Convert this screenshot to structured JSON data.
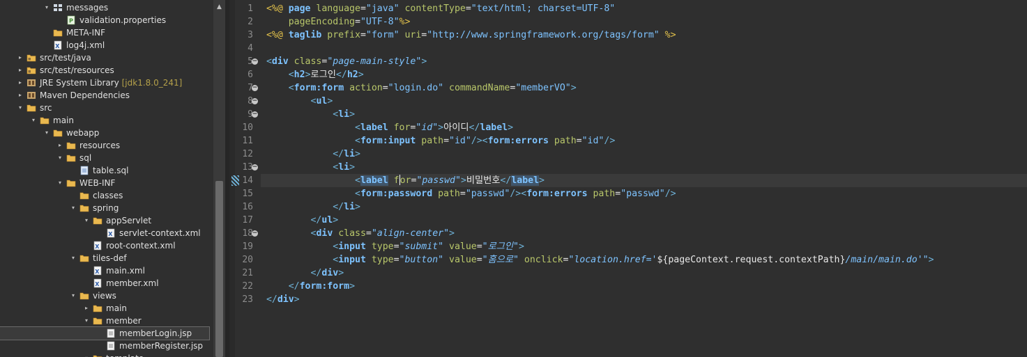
{
  "explorer": {
    "rows": [
      {
        "label": "messages",
        "twisty": "▾",
        "icon": "package-icon",
        "decoration": ""
      },
      {
        "label": "validation.properties",
        "twisty": "",
        "icon": "properties-file-icon",
        "decoration": ""
      },
      {
        "label": "META-INF",
        "twisty": "",
        "icon": "folder-icon",
        "decoration": ""
      },
      {
        "label": "log4j.xml",
        "twisty": "",
        "icon": "xml-file-icon",
        "decoration": ""
      },
      {
        "label": "src/test/java",
        "twisty": "▸",
        "icon": "source-folder-icon",
        "decoration": ""
      },
      {
        "label": "src/test/resources",
        "twisty": "▸",
        "icon": "source-folder-icon",
        "decoration": ""
      },
      {
        "label": "JRE System Library",
        "twisty": "▸",
        "icon": "library-icon",
        "decoration": "[jdk1.8.0_241]"
      },
      {
        "label": "Maven Dependencies",
        "twisty": "▸",
        "icon": "library-icon",
        "decoration": ""
      },
      {
        "label": "src",
        "twisty": "▾",
        "icon": "folder-icon",
        "decoration": ""
      },
      {
        "label": "main",
        "twisty": "▾",
        "icon": "folder-icon",
        "decoration": ""
      },
      {
        "label": "webapp",
        "twisty": "▾",
        "icon": "folder-icon",
        "decoration": ""
      },
      {
        "label": "resources",
        "twisty": "▸",
        "icon": "folder-icon",
        "decoration": ""
      },
      {
        "label": "sql",
        "twisty": "▾",
        "icon": "folder-icon",
        "decoration": ""
      },
      {
        "label": "table.sql",
        "twisty": "",
        "icon": "sql-file-icon",
        "decoration": ""
      },
      {
        "label": "WEB-INF",
        "twisty": "▾",
        "icon": "folder-icon",
        "decoration": ""
      },
      {
        "label": "classes",
        "twisty": "",
        "icon": "folder-icon",
        "decoration": ""
      },
      {
        "label": "spring",
        "twisty": "▾",
        "icon": "folder-icon",
        "decoration": ""
      },
      {
        "label": "appServlet",
        "twisty": "▾",
        "icon": "folder-icon",
        "decoration": ""
      },
      {
        "label": "servlet-context.xml",
        "twisty": "",
        "icon": "xml-file-icon",
        "decoration": ""
      },
      {
        "label": "root-context.xml",
        "twisty": "",
        "icon": "xml-file-icon",
        "decoration": ""
      },
      {
        "label": "tiles-def",
        "twisty": "▾",
        "icon": "folder-icon",
        "decoration": ""
      },
      {
        "label": "main.xml",
        "twisty": "",
        "icon": "xml-file-icon",
        "decoration": ""
      },
      {
        "label": "member.xml",
        "twisty": "",
        "icon": "xml-file-icon",
        "decoration": ""
      },
      {
        "label": "views",
        "twisty": "▾",
        "icon": "folder-icon",
        "decoration": ""
      },
      {
        "label": "main",
        "twisty": "▸",
        "icon": "folder-icon",
        "decoration": ""
      },
      {
        "label": "member",
        "twisty": "▾",
        "icon": "folder-icon",
        "decoration": ""
      },
      {
        "label": "memberLogin.jsp",
        "twisty": "",
        "icon": "jsp-file-icon",
        "decoration": "",
        "selected": true
      },
      {
        "label": "memberRegister.jsp",
        "twisty": "",
        "icon": "jsp-file-icon",
        "decoration": ""
      },
      {
        "label": "template",
        "twisty": "▾",
        "icon": "folder-icon",
        "decoration": ""
      }
    ]
  },
  "editor": {
    "lines": [
      {
        "num": "1",
        "fold": false,
        "tokens": [
          [
            "c-dir",
            "<%@ "
          ],
          [
            "c-kw",
            "page "
          ],
          [
            "c-attr",
            "language"
          ],
          [
            "c-el",
            "="
          ],
          [
            "c-str",
            "\"java\" "
          ],
          [
            "c-attr",
            "contentType"
          ],
          [
            "c-el",
            "="
          ],
          [
            "c-str",
            "\"text/html; charset=UTF-8\""
          ]
        ]
      },
      {
        "num": "2",
        "fold": false,
        "tokens": [
          [
            "c-el",
            "    "
          ],
          [
            "c-attr",
            "pageEncoding"
          ],
          [
            "c-el",
            "="
          ],
          [
            "c-str",
            "\"UTF-8\""
          ],
          [
            "c-dir",
            "%>"
          ]
        ]
      },
      {
        "num": "3",
        "fold": false,
        "tokens": [
          [
            "c-dir",
            "<%@ "
          ],
          [
            "c-kw",
            "taglib "
          ],
          [
            "c-attr",
            "prefix"
          ],
          [
            "c-el",
            "="
          ],
          [
            "c-str",
            "\"form\" "
          ],
          [
            "c-attr",
            "uri"
          ],
          [
            "c-el",
            "="
          ],
          [
            "c-str",
            "\"http://www.springframework.org/tags/form\" "
          ],
          [
            "c-dir",
            "%>"
          ]
        ]
      },
      {
        "num": "4",
        "fold": false,
        "tokens": []
      },
      {
        "num": "5",
        "fold": true,
        "tokens": [
          [
            "c-bracket",
            "<"
          ],
          [
            "c-tag",
            "div "
          ],
          [
            "c-attr",
            "class"
          ],
          [
            "c-el",
            "="
          ],
          [
            "c-stri",
            "\"page-main-style\""
          ],
          [
            "c-bracket",
            ">"
          ]
        ]
      },
      {
        "num": "6",
        "fold": false,
        "tokens": [
          [
            "c-el",
            "    "
          ],
          [
            "c-bracket",
            "<"
          ],
          [
            "c-tag",
            "h2"
          ],
          [
            "c-bracket",
            ">"
          ],
          [
            "c-txt",
            "로그인"
          ],
          [
            "c-bracket",
            "</"
          ],
          [
            "c-tag",
            "h2"
          ],
          [
            "c-bracket",
            ">"
          ]
        ]
      },
      {
        "num": "7",
        "fold": true,
        "tokens": [
          [
            "c-el",
            "    "
          ],
          [
            "c-bracket",
            "<"
          ],
          [
            "c-tag",
            "form:form "
          ],
          [
            "c-attr",
            "action"
          ],
          [
            "c-el",
            "="
          ],
          [
            "c-str",
            "\"login.do\" "
          ],
          [
            "c-attr",
            "commandName"
          ],
          [
            "c-el",
            "="
          ],
          [
            "c-str",
            "\"memberVO\""
          ],
          [
            "c-bracket",
            ">"
          ]
        ]
      },
      {
        "num": "8",
        "fold": true,
        "tokens": [
          [
            "c-el",
            "        "
          ],
          [
            "c-bracket",
            "<"
          ],
          [
            "c-tag",
            "ul"
          ],
          [
            "c-bracket",
            ">"
          ]
        ]
      },
      {
        "num": "9",
        "fold": true,
        "tokens": [
          [
            "c-el",
            "            "
          ],
          [
            "c-bracket",
            "<"
          ],
          [
            "c-tag",
            "li"
          ],
          [
            "c-bracket",
            ">"
          ]
        ]
      },
      {
        "num": "10",
        "fold": false,
        "tokens": [
          [
            "c-el",
            "                "
          ],
          [
            "c-bracket",
            "<"
          ],
          [
            "c-tag",
            "label "
          ],
          [
            "c-attr",
            "for"
          ],
          [
            "c-el",
            "="
          ],
          [
            "c-stri",
            "\"id\""
          ],
          [
            "c-bracket",
            ">"
          ],
          [
            "c-txt",
            "아이디"
          ],
          [
            "c-bracket",
            "</"
          ],
          [
            "c-tag",
            "label"
          ],
          [
            "c-bracket",
            ">"
          ]
        ]
      },
      {
        "num": "11",
        "fold": false,
        "tokens": [
          [
            "c-el",
            "                "
          ],
          [
            "c-bracket",
            "<"
          ],
          [
            "c-tag",
            "form:input "
          ],
          [
            "c-attr",
            "path"
          ],
          [
            "c-el",
            "="
          ],
          [
            "c-str",
            "\"id\""
          ],
          [
            "c-bracket",
            "/><"
          ],
          [
            "c-tag",
            "form:errors "
          ],
          [
            "c-attr",
            "path"
          ],
          [
            "c-el",
            "="
          ],
          [
            "c-str",
            "\"id\""
          ],
          [
            "c-bracket",
            "/>"
          ]
        ]
      },
      {
        "num": "12",
        "fold": false,
        "tokens": [
          [
            "c-el",
            "            "
          ],
          [
            "c-bracket",
            "</"
          ],
          [
            "c-tag",
            "li"
          ],
          [
            "c-bracket",
            ">"
          ]
        ]
      },
      {
        "num": "13",
        "fold": true,
        "tokens": [
          [
            "c-el",
            "            "
          ],
          [
            "c-bracket",
            "<"
          ],
          [
            "c-tag",
            "li"
          ],
          [
            "c-bracket",
            ">"
          ]
        ]
      },
      {
        "num": "14",
        "fold": false,
        "current": true,
        "tokens": [
          [
            "c-el",
            "                "
          ],
          [
            "c-bracket",
            "<"
          ],
          [
            "hl",
            "label"
          ],
          [
            "c-el",
            " "
          ],
          [
            "c-attr",
            "f"
          ],
          [
            "caret",
            ""
          ],
          [
            "c-attr",
            "or"
          ],
          [
            "c-el",
            "="
          ],
          [
            "c-stri",
            "\"passwd\""
          ],
          [
            "c-bracket",
            ">"
          ],
          [
            "c-txt",
            "비밀번호"
          ],
          [
            "c-bracket",
            "</"
          ],
          [
            "hl",
            "label"
          ],
          [
            "c-bracket",
            ">"
          ]
        ]
      },
      {
        "num": "15",
        "fold": false,
        "tokens": [
          [
            "c-el",
            "                "
          ],
          [
            "c-bracket",
            "<"
          ],
          [
            "c-tag",
            "form:password "
          ],
          [
            "c-attr",
            "path"
          ],
          [
            "c-el",
            "="
          ],
          [
            "c-str",
            "\"passwd\""
          ],
          [
            "c-bracket",
            "/><"
          ],
          [
            "c-tag",
            "form:errors "
          ],
          [
            "c-attr",
            "path"
          ],
          [
            "c-el",
            "="
          ],
          [
            "c-str",
            "\"passwd\""
          ],
          [
            "c-bracket",
            "/>"
          ]
        ]
      },
      {
        "num": "16",
        "fold": false,
        "tokens": [
          [
            "c-el",
            "            "
          ],
          [
            "c-bracket",
            "</"
          ],
          [
            "c-tag",
            "li"
          ],
          [
            "c-bracket",
            ">"
          ]
        ]
      },
      {
        "num": "17",
        "fold": false,
        "tokens": [
          [
            "c-el",
            "        "
          ],
          [
            "c-bracket",
            "</"
          ],
          [
            "c-tag",
            "ul"
          ],
          [
            "c-bracket",
            ">"
          ]
        ]
      },
      {
        "num": "18",
        "fold": true,
        "tokens": [
          [
            "c-el",
            "        "
          ],
          [
            "c-bracket",
            "<"
          ],
          [
            "c-tag",
            "div "
          ],
          [
            "c-attr",
            "class"
          ],
          [
            "c-el",
            "="
          ],
          [
            "c-stri",
            "\"align-center\""
          ],
          [
            "c-bracket",
            ">"
          ]
        ]
      },
      {
        "num": "19",
        "fold": false,
        "tokens": [
          [
            "c-el",
            "            "
          ],
          [
            "c-bracket",
            "<"
          ],
          [
            "c-tag",
            "input "
          ],
          [
            "c-attr",
            "type"
          ],
          [
            "c-el",
            "="
          ],
          [
            "c-stri",
            "\"submit\" "
          ],
          [
            "c-attr",
            "value"
          ],
          [
            "c-el",
            "="
          ],
          [
            "c-stri",
            "\"로그인\""
          ],
          [
            "c-bracket",
            ">"
          ]
        ]
      },
      {
        "num": "20",
        "fold": false,
        "tokens": [
          [
            "c-el",
            "            "
          ],
          [
            "c-bracket",
            "<"
          ],
          [
            "c-tag",
            "input "
          ],
          [
            "c-attr",
            "type"
          ],
          [
            "c-el",
            "="
          ],
          [
            "c-stri",
            "\"button\" "
          ],
          [
            "c-attr",
            "value"
          ],
          [
            "c-el",
            "="
          ],
          [
            "c-stri",
            "\"홈으로\" "
          ],
          [
            "c-attr",
            "onclick"
          ],
          [
            "c-el",
            "="
          ],
          [
            "c-stri",
            "\"location.href='"
          ],
          [
            "c-el",
            "${pageContext.request.contextPath}"
          ],
          [
            "c-stri",
            "/main/main.do'\""
          ],
          [
            "c-bracket",
            ">"
          ]
        ]
      },
      {
        "num": "21",
        "fold": false,
        "tokens": [
          [
            "c-el",
            "        "
          ],
          [
            "c-bracket",
            "</"
          ],
          [
            "c-tag",
            "div"
          ],
          [
            "c-bracket",
            ">"
          ]
        ]
      },
      {
        "num": "22",
        "fold": false,
        "tokens": [
          [
            "c-el",
            "    "
          ],
          [
            "c-bracket",
            "</"
          ],
          [
            "c-tag",
            "form:form"
          ],
          [
            "c-bracket",
            ">"
          ]
        ]
      },
      {
        "num": "23",
        "fold": false,
        "tokens": [
          [
            "c-bracket",
            "</"
          ],
          [
            "c-tag",
            "div"
          ],
          [
            "c-bracket",
            ">"
          ]
        ]
      }
    ]
  }
}
